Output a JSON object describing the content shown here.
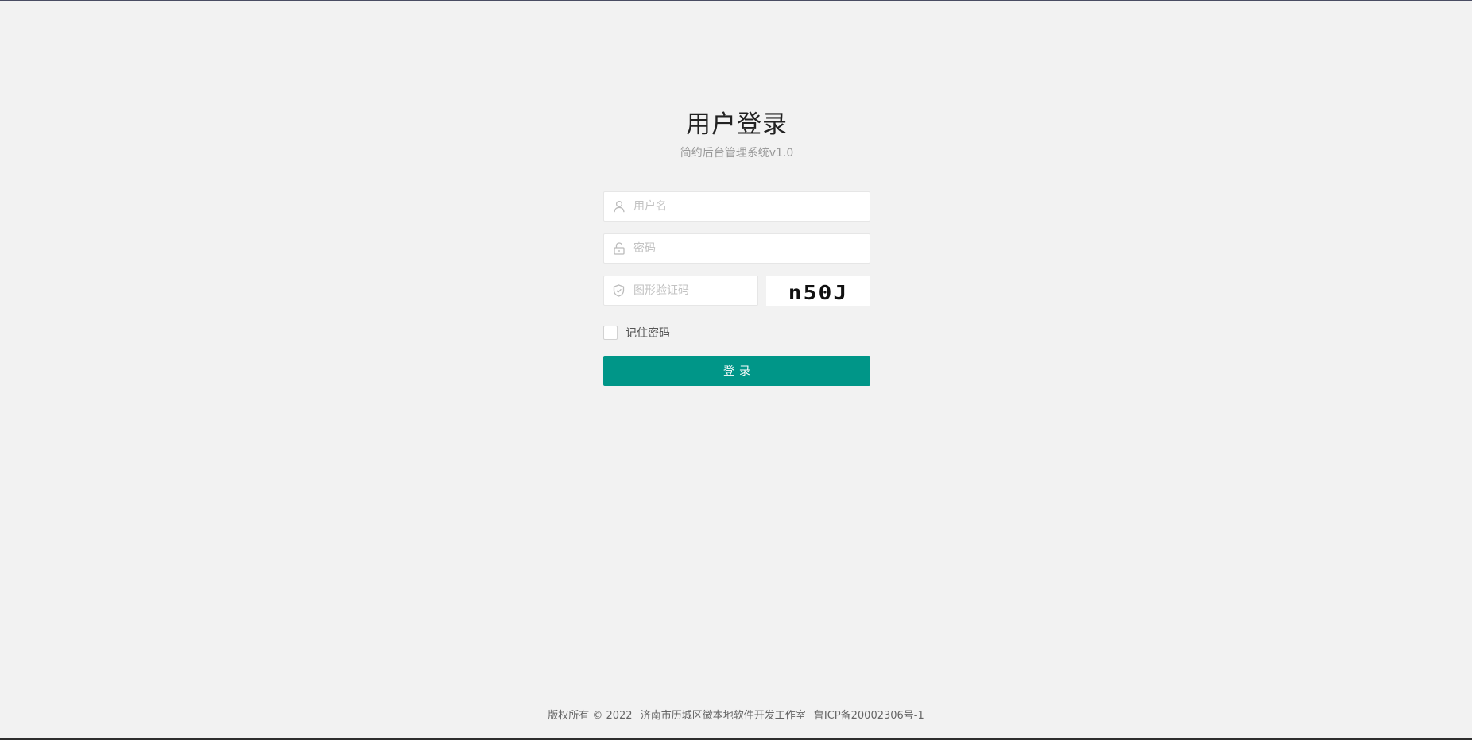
{
  "login": {
    "title": "用户登录",
    "subtitle": "简约后台管理系统v1.0",
    "username_placeholder": "用户名",
    "password_placeholder": "密码",
    "captcha_placeholder": "图形验证码",
    "captcha_text": "n50J",
    "remember_label": "记住密码",
    "submit_label": "登录"
  },
  "icons": {
    "username": "user-icon",
    "password": "lock-icon",
    "captcha": "shield-icon"
  },
  "colors": {
    "primary": "#009688",
    "background": "#f2f2f2"
  },
  "footer": {
    "copyright": "版权所有 © 2022",
    "company": "济南市历城区微本地软件开发工作室",
    "icp": "鲁ICP备20002306号-1"
  }
}
